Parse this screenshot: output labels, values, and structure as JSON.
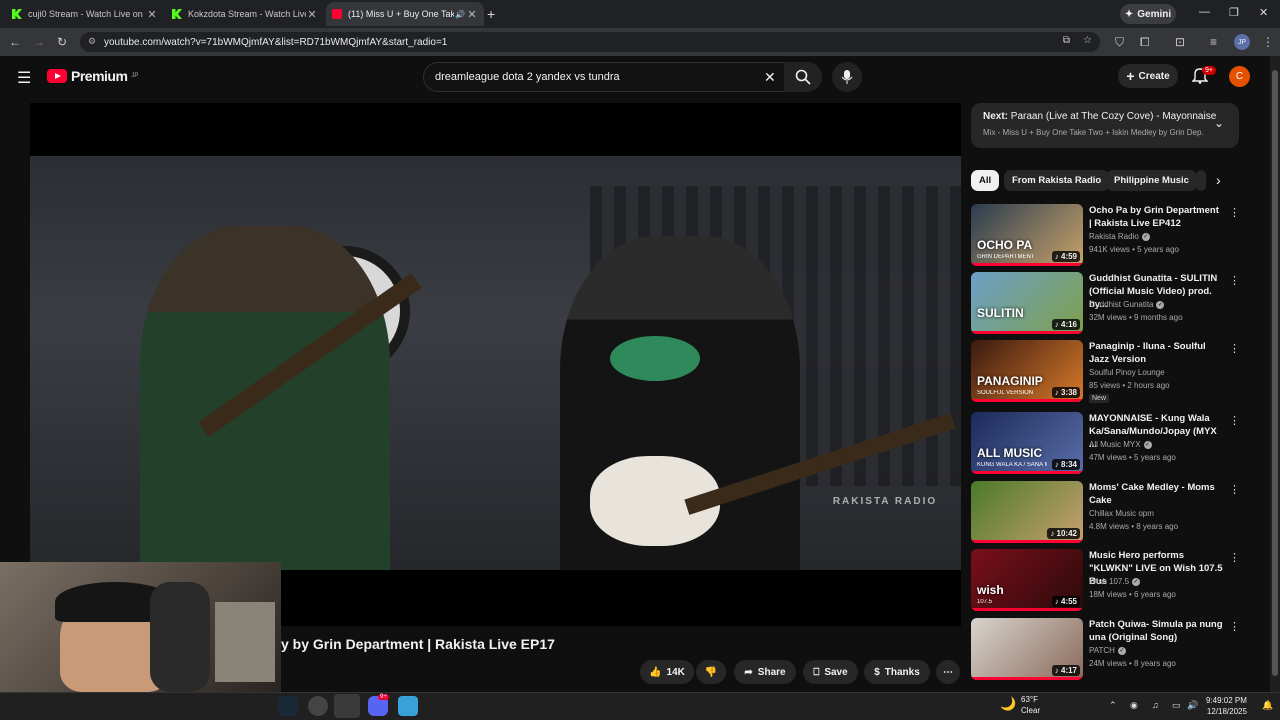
{
  "browser": {
    "tabs": [
      {
        "title": "cuji0 Stream - Watch Live on K",
        "icon": "kick-icon",
        "active": false
      },
      {
        "title": "Kokzdota Stream - Watch Live o",
        "icon": "kick-icon",
        "active": false
      },
      {
        "title": "(11) Miss U + Buy One Take",
        "icon": "youtube-icon",
        "active": true
      }
    ],
    "new_tab": "+",
    "gemini_label": "Gemini",
    "url": "youtube.com/watch?v=71bWMQjmfAY&list=RD71bWMQjmfAY&start_radio=1",
    "profile_initials": "JP"
  },
  "youtube": {
    "logo_text": "Premium",
    "logo_region": "JP",
    "search_value": "dreamleague dota 2 yandex vs tundra",
    "create_label": "Create",
    "notifications": "9+",
    "avatar_letter": "C"
  },
  "video": {
    "title_visible": "y by Grin Department | Rakista Live EP17",
    "watermark": "RAKISTA RADIO",
    "actions": {
      "like_count": "14K",
      "share": "Share",
      "save": "Save",
      "thanks": "Thanks"
    }
  },
  "up_next": {
    "prefix": "Next:",
    "title": "Paraan (Live at The Cozy Cove) - Mayonnaise",
    "subtitle": "Mix - Miss U + Buy One Take Two + Iskin Medley by Grin Dep..."
  },
  "chips": [
    "All",
    "From Rakista Radio",
    "Philippine Music"
  ],
  "recommendations": [
    {
      "title": "Ocho Pa by Grin Department | Rakista Live EP412",
      "channel": "Rakista Radio",
      "verified": true,
      "meta": "941K views • 5 years ago",
      "duration": "4:59",
      "thumb_text": "OCHO PA",
      "thumb_sub": "GRIN DEPARTMENT",
      "color_a": "#2a3c4f",
      "color_b": "#c9a36a"
    },
    {
      "title": "Guddhist Gunatita - SULITIN (Official Music Video) prod. by...",
      "channel": "Guddhist Gunatita",
      "verified": true,
      "meta": "32M views • 9 months ago",
      "duration": "4:16",
      "thumb_text": "SULITIN",
      "thumb_sub": "",
      "color_a": "#6aa0c8",
      "color_b": "#7fa04a"
    },
    {
      "title": "Panaginip - Iluna - Soulful Jazz Version",
      "channel": "Soulful Pinoy Lounge",
      "verified": false,
      "meta": "85 views • 2 hours ago",
      "new": "New",
      "duration": "3:38",
      "thumb_text": "PANAGINIP",
      "thumb_sub": "SOULFUL VERSION",
      "color_a": "#3a1a10",
      "color_b": "#d87a2a"
    },
    {
      "title": "MAYONNAISE - Kung Wala Ka/Sana/Mundo/Jopay (MYX ...",
      "channel": "All Music MYX",
      "verified": true,
      "meta": "47M views • 5 years ago",
      "duration": "8:34",
      "thumb_text": "ALL MUSIC",
      "thumb_sub": "KUNG WALA KA / SANA MUNDO / JOPAY",
      "color_a": "#1b2a5a",
      "color_b": "#5a6ea8"
    },
    {
      "title": "Moms' Cake Medley - Moms Cake",
      "channel": "Chillax Music opm",
      "verified": false,
      "meta": "4.8M views • 8 years ago",
      "duration": "10:42",
      "thumb_text": "",
      "thumb_sub": "",
      "color_a": "#4a7a2a",
      "color_b": "#c8a070"
    },
    {
      "title": "Music Hero performs \"KLWKN\" LIVE on Wish 107.5 Bus",
      "channel": "Wish 107.5",
      "verified": true,
      "meta": "18M views • 6 years ago",
      "duration": "4:55",
      "thumb_text": "wish",
      "thumb_sub": "107.5",
      "color_a": "#7a0f1a",
      "color_b": "#2a0a0a"
    },
    {
      "title": "Patch Quiwa- Simula pa nung una (Original Song)",
      "channel": "PATCH",
      "verified": true,
      "meta": "24M views • 8 years ago",
      "duration": "4:17",
      "thumb_text": "",
      "thumb_sub": "",
      "color_a": "#d8d4ce",
      "color_b": "#8a6a5a"
    }
  ],
  "taskbar": {
    "weather_temp": "63°F",
    "weather_desc": "Clear",
    "time": "9:49:02 PM",
    "date": "12/18/2025",
    "discord_badge": "9+"
  }
}
